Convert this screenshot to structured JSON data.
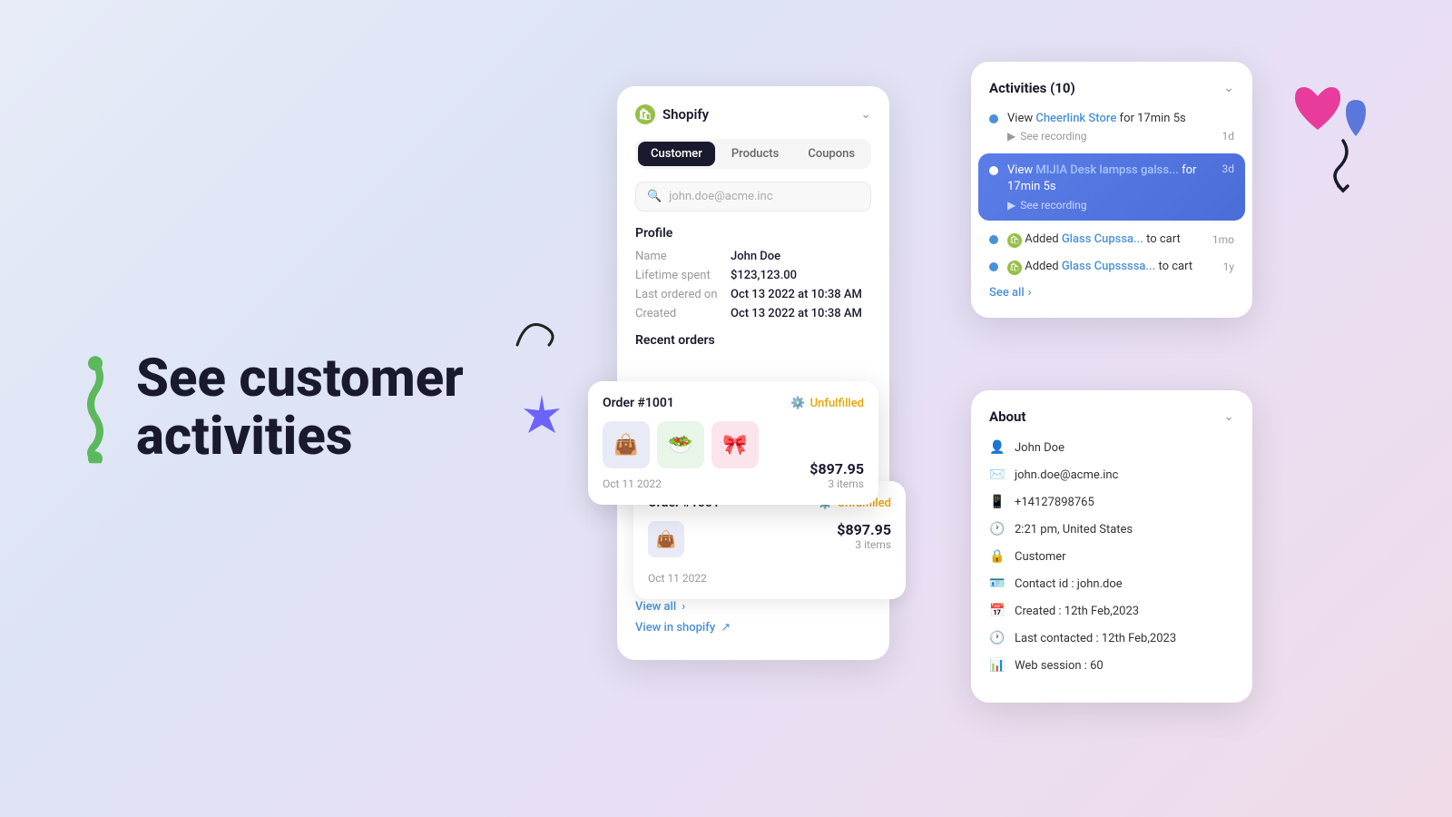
{
  "hero": {
    "line1": "See customer",
    "line2": "activities"
  },
  "shopify": {
    "brand": "Shopify",
    "chevron": "⌄",
    "tabs": [
      {
        "label": "Customer",
        "active": true
      },
      {
        "label": "Products",
        "active": false
      },
      {
        "label": "Coupons",
        "active": false
      }
    ],
    "search_placeholder": "john.doe@acme.inc",
    "profile": {
      "title": "Profile",
      "fields": [
        {
          "label": "Name",
          "value": "John Doe"
        },
        {
          "label": "Lifetime spent",
          "value": "$123,123.00"
        },
        {
          "label": "Last ordered on",
          "value": "Oct 13 2022 at 10:38 AM"
        },
        {
          "label": "Created",
          "value": "Oct 13 2022 at 10:38 AM"
        }
      ]
    },
    "recent_orders_title": "Recent orders",
    "view_all": "View all",
    "view_in_shopify": "View in shopify"
  },
  "order_front": {
    "number": "Order #1001",
    "status": "Unfulfilled",
    "total": "$897.95",
    "items_count": "3 items",
    "date": "Oct 11 2022",
    "items": [
      "👜",
      "🥗",
      "🎀"
    ]
  },
  "order_back": {
    "number": "Order #1001",
    "status": "Unfulfilled",
    "total": "$897.95",
    "items_count": "3 items",
    "date": "Oct 11 2022"
  },
  "activities": {
    "title": "Activities (10)",
    "items": [
      {
        "text_before": "View ",
        "link": "Cheerlink Store",
        "text_after": " for 17min 5s",
        "sub": "See recording",
        "time": "1d",
        "highlighted": false
      },
      {
        "text_before": "View ",
        "link": "MIJIA Desk lampss galss...",
        "text_after": " for 17min 5s",
        "sub": "See recording",
        "time": "3d",
        "highlighted": true
      },
      {
        "text_before": "Added ",
        "link": "Glass Cupssa...",
        "text_after": " to cart",
        "sub": "",
        "time": "1mo",
        "highlighted": false,
        "has_product_icon": true
      },
      {
        "text_before": "Added ",
        "link": "Glass Cupssssa...",
        "text_after": " to cart",
        "sub": "",
        "time": "1y",
        "highlighted": false,
        "has_product_icon": true
      }
    ],
    "see_all": "See all"
  },
  "about": {
    "title": "About",
    "fields": [
      {
        "icon": "👤",
        "value": "John Doe"
      },
      {
        "icon": "✉️",
        "value": "john.doe@acme.inc"
      },
      {
        "icon": "📱",
        "value": "+14127898765"
      },
      {
        "icon": "🕐",
        "value": "2:21 pm, United States"
      },
      {
        "icon": "🔒",
        "value": "Customer"
      },
      {
        "icon": "🪪",
        "value": "Contact id : john.doe"
      },
      {
        "icon": "📅",
        "value": "Created : 12th Feb,2023"
      },
      {
        "icon": "🕐",
        "value": "Last contacted : 12th Feb,2023"
      },
      {
        "icon": "📊",
        "value": "Web session : 60"
      }
    ]
  }
}
